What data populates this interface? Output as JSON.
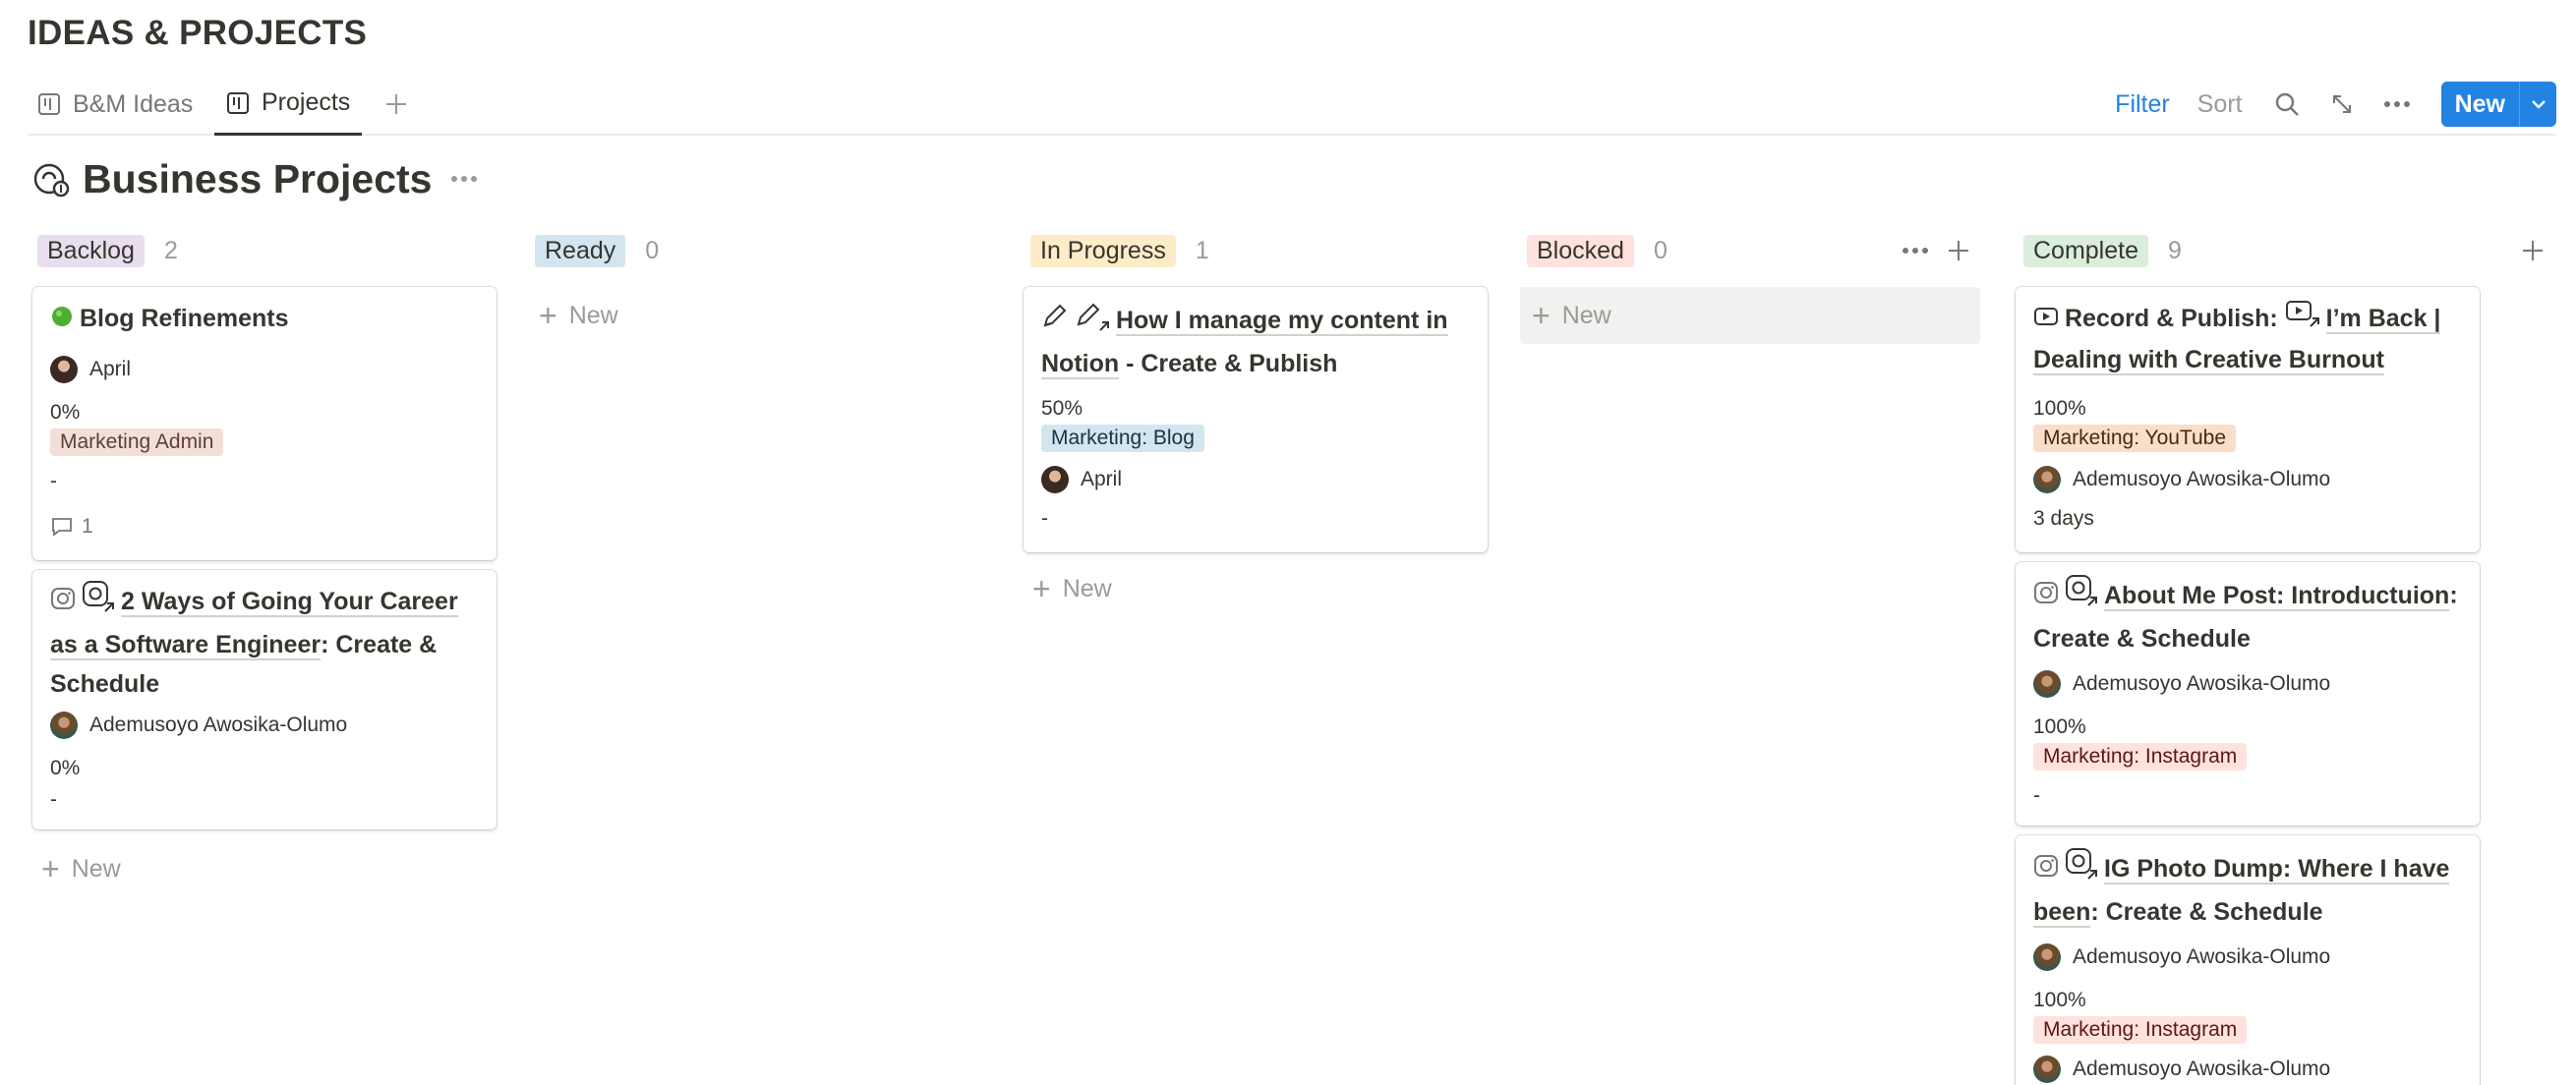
{
  "page": {
    "title": "IDEAS & PROJECTS"
  },
  "tabs": [
    {
      "label": "B&M Ideas"
    },
    {
      "label": "Projects"
    }
  ],
  "toolbar": {
    "filter": "Filter",
    "sort": "Sort",
    "new": "New"
  },
  "database": {
    "title": "Business Projects"
  },
  "colors": {
    "accent": "#2383e2",
    "backlog": "#e8deee",
    "ready": "#d3e5ef",
    "in_progress": "#fdecc8",
    "blocked": "#ffe2dd",
    "complete": "#dbeddb",
    "marketing_admin": "#f4dfd8",
    "marketing_blog": "#d3e5ef",
    "marketing_youtube": "#fadec9",
    "marketing_instagram": "#ffe2dd"
  },
  "groups": [
    {
      "name": "Backlog",
      "count": "2"
    },
    {
      "name": "Ready",
      "count": "0"
    },
    {
      "name": "In Progress",
      "count": "1"
    },
    {
      "name": "Blocked",
      "count": "0"
    },
    {
      "name": "Complete",
      "count": "9"
    }
  ],
  "new_label": "New",
  "cards": {
    "blog_refinements": {
      "title": "Blog Refinements",
      "person": "April",
      "progress": "0%",
      "tag": "Marketing Admin",
      "dash": "-",
      "comments": "1"
    },
    "career": {
      "title_link": "2 Ways of Going Your Career as a Software Engineer",
      "title_rest": ": Create & Schedule",
      "person": "Ademusoyo Awosika-Olumo",
      "progress": "0%",
      "dash": "-"
    },
    "content_notion": {
      "title_link": "How I manage my content in Notion",
      "title_rest": " - Create & Publish",
      "progress": "50%",
      "tag": "Marketing: Blog",
      "person": "April",
      "dash": "-"
    },
    "record_publish": {
      "title_prefix": "Record & Publish: ",
      "title_link": "I’m Back | Dealing with Creative Burnout",
      "progress": "100%",
      "tag": "Marketing: YouTube",
      "person": "Ademusoyo Awosika-Olumo",
      "duration": "3 days"
    },
    "about_me": {
      "title_link": "About Me Post: Introductuion",
      "title_rest": ": Create & Schedule",
      "person": "Ademusoyo Awosika-Olumo",
      "progress": "100%",
      "tag": "Marketing: Instagram",
      "dash": "-"
    },
    "photo_dump": {
      "title_link": "IG Photo Dump: Where I have been",
      "title_rest": ": Create & Schedule",
      "person": "Ademusoyo Awosika-Olumo",
      "progress": "100%",
      "tag": "Marketing: Instagram",
      "person2": "Ademusoyo Awosika-Olumo"
    }
  }
}
